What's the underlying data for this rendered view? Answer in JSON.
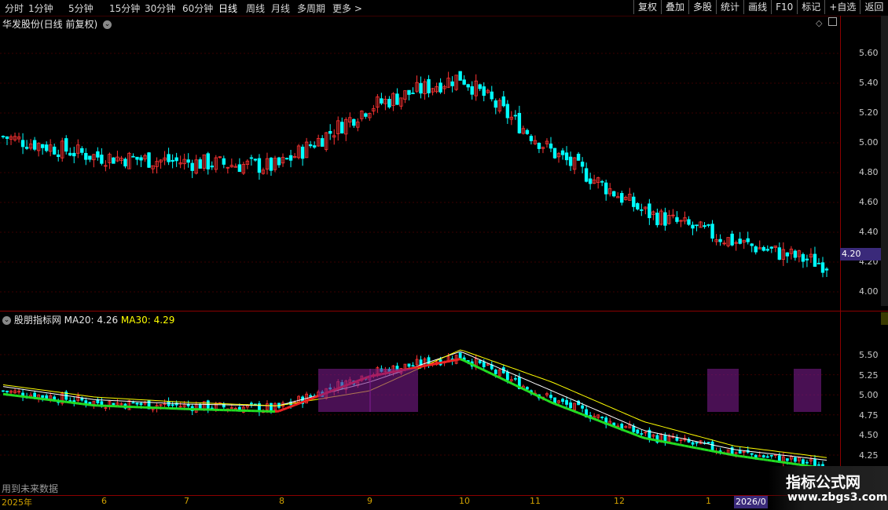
{
  "toolbar": {
    "timeframes": [
      "分时",
      "1分钟",
      "5分钟",
      "15分钟",
      "30分钟",
      "60分钟",
      "日线",
      "周线",
      "月线",
      "多周期"
    ],
    "more": "更多",
    "right_buttons": [
      "复权",
      "叠加",
      "多股",
      "统计",
      "画线",
      "F10",
      "标记",
      "+自选",
      "返回"
    ]
  },
  "main_panel": {
    "title": "华发股份(日线 前复权)",
    "price_ticks": [
      "5.60",
      "5.40",
      "5.20",
      "5.00",
      "4.80",
      "4.60",
      "4.40",
      "4.20",
      "4.00"
    ],
    "current_price": "4.20"
  },
  "indicator_panel": {
    "name": "股朋指标网",
    "ma20_label": "MA20:",
    "ma20_value": "4.26",
    "ma30_label": "MA30:",
    "ma30_value": "4.29",
    "ticks": [
      "5.50",
      "5.25",
      "5.00",
      "4.75",
      "4.50",
      "4.25"
    ],
    "note": "用到未来数据"
  },
  "time_axis": {
    "labels": [
      "2025年",
      "6",
      "7",
      "8",
      "9",
      "10",
      "11",
      "12",
      "1"
    ],
    "current_date": "2026/0"
  },
  "watermark": {
    "line1": "指标公式网",
    "line2": "www.zbgs3.com"
  },
  "chart_data": {
    "type": "line",
    "title": "华发股份(日线 前复权)",
    "x": [
      "2025-05",
      "2025-06",
      "2025-07",
      "2025-08",
      "2025-09",
      "2025-10",
      "2025-11",
      "2025-12",
      "2026-01",
      "2026-02"
    ],
    "series": [
      {
        "name": "close",
        "values": [
          5.05,
          4.92,
          4.88,
          4.85,
          5.25,
          5.45,
          4.95,
          4.55,
          4.35,
          4.2
        ]
      },
      {
        "name": "MA20",
        "values": [
          5.1,
          4.95,
          4.9,
          4.88,
          5.15,
          5.5,
          5.05,
          4.6,
          4.38,
          4.26
        ]
      },
      {
        "name": "MA30",
        "values": [
          5.12,
          4.98,
          4.92,
          4.88,
          5.05,
          5.52,
          5.15,
          4.7,
          4.42,
          4.29
        ]
      }
    ],
    "ylim": [
      3.95,
      5.75
    ],
    "colors": {
      "up": "#ff3333",
      "down": "#00ffff",
      "ma20": "#ffffff",
      "ma30": "#ffff00"
    }
  }
}
